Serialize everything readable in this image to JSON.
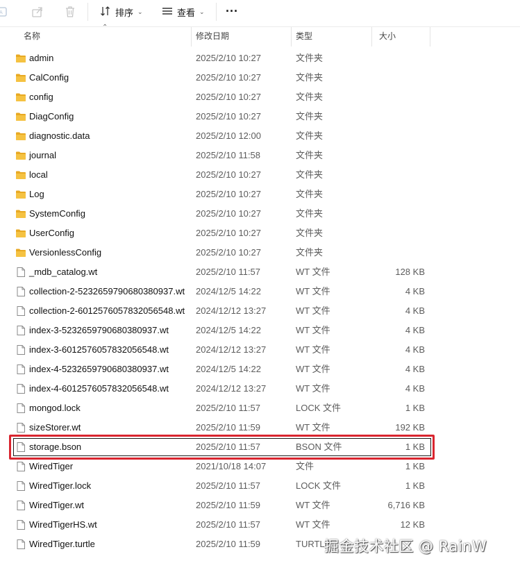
{
  "toolbar": {
    "sort_label": "排序",
    "view_label": "查看",
    "more_label": "···"
  },
  "columns": {
    "name": "名称",
    "date": "修改日期",
    "type": "类型",
    "size": "大小"
  },
  "files": [
    {
      "name": "admin",
      "date": "2025/2/10 10:27",
      "type": "文件夹",
      "size": "",
      "kind": "folder"
    },
    {
      "name": "CalConfig",
      "date": "2025/2/10 10:27",
      "type": "文件夹",
      "size": "",
      "kind": "folder"
    },
    {
      "name": "config",
      "date": "2025/2/10 10:27",
      "type": "文件夹",
      "size": "",
      "kind": "folder"
    },
    {
      "name": "DiagConfig",
      "date": "2025/2/10 10:27",
      "type": "文件夹",
      "size": "",
      "kind": "folder"
    },
    {
      "name": "diagnostic.data",
      "date": "2025/2/10 12:00",
      "type": "文件夹",
      "size": "",
      "kind": "folder"
    },
    {
      "name": "journal",
      "date": "2025/2/10 11:58",
      "type": "文件夹",
      "size": "",
      "kind": "folder"
    },
    {
      "name": "local",
      "date": "2025/2/10 10:27",
      "type": "文件夹",
      "size": "",
      "kind": "folder"
    },
    {
      "name": "Log",
      "date": "2025/2/10 10:27",
      "type": "文件夹",
      "size": "",
      "kind": "folder"
    },
    {
      "name": "SystemConfig",
      "date": "2025/2/10 10:27",
      "type": "文件夹",
      "size": "",
      "kind": "folder"
    },
    {
      "name": "UserConfig",
      "date": "2025/2/10 10:27",
      "type": "文件夹",
      "size": "",
      "kind": "folder"
    },
    {
      "name": "VersionlessConfig",
      "date": "2025/2/10 10:27",
      "type": "文件夹",
      "size": "",
      "kind": "folder"
    },
    {
      "name": "_mdb_catalog.wt",
      "date": "2025/2/10 11:57",
      "type": "WT 文件",
      "size": "128 KB",
      "kind": "file"
    },
    {
      "name": "collection-2-5232659790680380937.wt",
      "date": "2024/12/5 14:22",
      "type": "WT 文件",
      "size": "4 KB",
      "kind": "file"
    },
    {
      "name": "collection-2-6012576057832056548.wt",
      "date": "2024/12/12 13:27",
      "type": "WT 文件",
      "size": "4 KB",
      "kind": "file"
    },
    {
      "name": "index-3-5232659790680380937.wt",
      "date": "2024/12/5 14:22",
      "type": "WT 文件",
      "size": "4 KB",
      "kind": "file"
    },
    {
      "name": "index-3-6012576057832056548.wt",
      "date": "2024/12/12 13:27",
      "type": "WT 文件",
      "size": "4 KB",
      "kind": "file"
    },
    {
      "name": "index-4-5232659790680380937.wt",
      "date": "2024/12/5 14:22",
      "type": "WT 文件",
      "size": "4 KB",
      "kind": "file"
    },
    {
      "name": "index-4-6012576057832056548.wt",
      "date": "2024/12/12 13:27",
      "type": "WT 文件",
      "size": "4 KB",
      "kind": "file"
    },
    {
      "name": "mongod.lock",
      "date": "2025/2/10 11:57",
      "type": "LOCK 文件",
      "size": "1 KB",
      "kind": "file"
    },
    {
      "name": "sizeStorer.wt",
      "date": "2025/2/10 11:59",
      "type": "WT 文件",
      "size": "192 KB",
      "kind": "file"
    },
    {
      "name": "storage.bson",
      "date": "2025/2/10 11:57",
      "type": "BSON 文件",
      "size": "1 KB",
      "kind": "file",
      "selected": true
    },
    {
      "name": "WiredTiger",
      "date": "2021/10/18 14:07",
      "type": "文件",
      "size": "1 KB",
      "kind": "file"
    },
    {
      "name": "WiredTiger.lock",
      "date": "2025/2/10 11:57",
      "type": "LOCK 文件",
      "size": "1 KB",
      "kind": "file"
    },
    {
      "name": "WiredTiger.wt",
      "date": "2025/2/10 11:59",
      "type": "WT 文件",
      "size": "6,716 KB",
      "kind": "file"
    },
    {
      "name": "WiredTigerHS.wt",
      "date": "2025/2/10 11:57",
      "type": "WT 文件",
      "size": "12 KB",
      "kind": "file"
    },
    {
      "name": "WiredTiger.turtle",
      "date": "2025/2/10 11:59",
      "type": "TURTLE",
      "size": "",
      "kind": "file"
    }
  ],
  "watermark": "掘金技术社区 @ RainW",
  "colors": {
    "folder": "#f5c242",
    "highlight": "#d9252f"
  }
}
